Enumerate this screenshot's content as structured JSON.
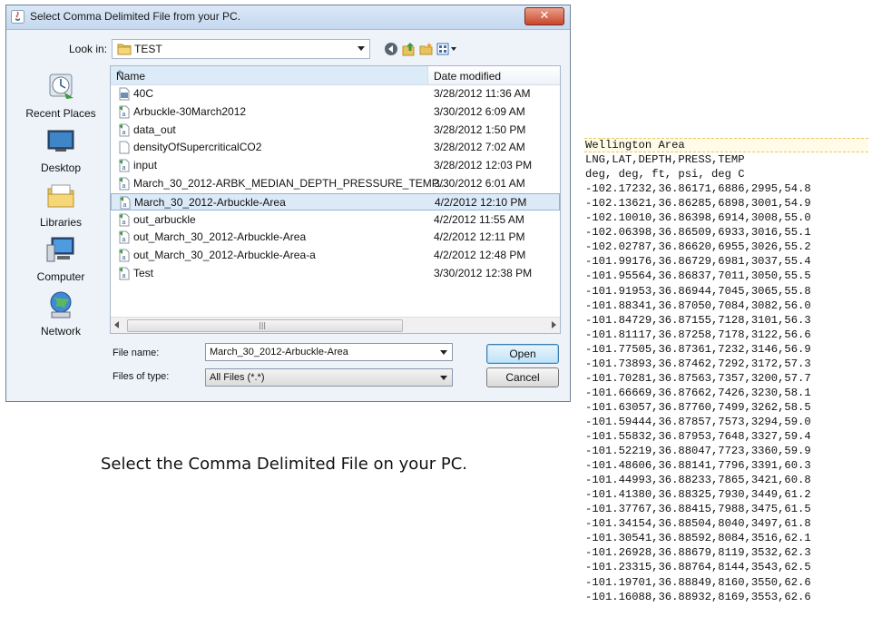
{
  "window": {
    "title": "Select Comma Delimited File from your PC.",
    "close_symbol": "✕"
  },
  "look_in": {
    "label": "Look in:",
    "value": "TEST"
  },
  "toolbar_icons": [
    "back-icon",
    "up-folder-icon",
    "new-folder-icon",
    "view-menu-icon"
  ],
  "places": [
    {
      "label": "Recent Places",
      "icon": "recent-places-icon"
    },
    {
      "label": "Desktop",
      "icon": "desktop-icon"
    },
    {
      "label": "Libraries",
      "icon": "libraries-icon"
    },
    {
      "label": "Computer",
      "icon": "computer-icon"
    },
    {
      "label": "Network",
      "icon": "network-icon"
    }
  ],
  "file_list": {
    "columns": {
      "name": "Name",
      "date": "Date modified"
    },
    "rows": [
      {
        "name": "40C",
        "date": "3/28/2012 11:36 AM",
        "icon": "binary-file-icon"
      },
      {
        "name": "Arbuckle-30March2012",
        "date": "3/30/2012 6:09 AM",
        "icon": "data-file-icon"
      },
      {
        "name": "data_out",
        "date": "3/28/2012 1:50 PM",
        "icon": "data-file-icon"
      },
      {
        "name": "densityOfSupercriticalCO2",
        "date": "3/28/2012 7:02 AM",
        "icon": "blank-file-icon"
      },
      {
        "name": "input",
        "date": "3/28/2012 12:03 PM",
        "icon": "data-file-icon"
      },
      {
        "name": "March_30_2012-ARBK_MEDIAN_DEPTH_PRESSURE_TEMP...",
        "date": "3/30/2012 6:01 AM",
        "icon": "data-file-icon"
      },
      {
        "name": "March_30_2012-Arbuckle-Area",
        "date": "4/2/2012 12:10 PM",
        "icon": "data-file-icon",
        "selected": true
      },
      {
        "name": "out_arbuckle",
        "date": "4/2/2012 11:55 AM",
        "icon": "data-file-icon"
      },
      {
        "name": "out_March_30_2012-Arbuckle-Area",
        "date": "4/2/2012 12:11 PM",
        "icon": "data-file-icon"
      },
      {
        "name": "out_March_30_2012-Arbuckle-Area-a",
        "date": "4/2/2012 12:48 PM",
        "icon": "data-file-icon"
      },
      {
        "name": "Test",
        "date": "3/30/2012 12:38 PM",
        "icon": "data-file-icon"
      }
    ],
    "scroll_grip": "|||"
  },
  "file_name": {
    "label": "File name:",
    "value": "March_30_2012-Arbuckle-Area"
  },
  "file_type": {
    "label": "Files of type:",
    "value": "All Files (*.*)"
  },
  "buttons": {
    "open": "Open",
    "cancel": "Cancel"
  },
  "caption": "Select the Comma Delimited File on your PC.",
  "csv_preview": {
    "lines": [
      "Wellington Area",
      "LNG,LAT,DEPTH,PRESS,TEMP",
      "deg, deg, ft, psi, deg C",
      "-102.17232,36.86171,6886,2995,54.8",
      "-102.13621,36.86285,6898,3001,54.9",
      "-102.10010,36.86398,6914,3008,55.0",
      "-102.06398,36.86509,6933,3016,55.1",
      "-102.02787,36.86620,6955,3026,55.2",
      "-101.99176,36.86729,6981,3037,55.4",
      "-101.95564,36.86837,7011,3050,55.5",
      "-101.91953,36.86944,7045,3065,55.8",
      "-101.88341,36.87050,7084,3082,56.0",
      "-101.84729,36.87155,7128,3101,56.3",
      "-101.81117,36.87258,7178,3122,56.6",
      "-101.77505,36.87361,7232,3146,56.9",
      "-101.73893,36.87462,7292,3172,57.3",
      "-101.70281,36.87563,7357,3200,57.7",
      "-101.66669,36.87662,7426,3230,58.1",
      "-101.63057,36.87760,7499,3262,58.5",
      "-101.59444,36.87857,7573,3294,59.0",
      "-101.55832,36.87953,7648,3327,59.4",
      "-101.52219,36.88047,7723,3360,59.9",
      "-101.48606,36.88141,7796,3391,60.3",
      "-101.44993,36.88233,7865,3421,60.8",
      "-101.41380,36.88325,7930,3449,61.2",
      "-101.37767,36.88415,7988,3475,61.5",
      "-101.34154,36.88504,8040,3497,61.8",
      "-101.30541,36.88592,8084,3516,62.1",
      "-101.26928,36.88679,8119,3532,62.3",
      "-101.23315,36.88764,8144,3543,62.5",
      "-101.19701,36.88849,8160,3550,62.6",
      "-101.16088,36.88932,8169,3553,62.6"
    ]
  }
}
